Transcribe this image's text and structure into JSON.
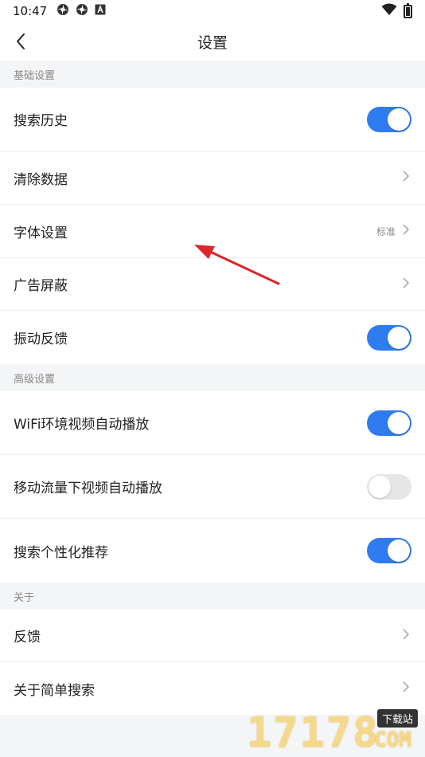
{
  "status_bar": {
    "time": "10:47"
  },
  "header": {
    "title": "设置"
  },
  "sections": {
    "basic": {
      "title": "基础设置"
    },
    "advanced": {
      "title": "高级设置"
    },
    "about": {
      "title": "关于"
    }
  },
  "rows": {
    "search_history": {
      "label": "搜索历史",
      "enabled": true
    },
    "clear_data": {
      "label": "清除数据"
    },
    "font_settings": {
      "label": "字体设置",
      "value": "标准"
    },
    "ad_block": {
      "label": "广告屏蔽"
    },
    "vibration": {
      "label": "振动反馈",
      "enabled": true
    },
    "wifi_autoplay": {
      "label": "WiFi环境视频自动播放",
      "enabled": true
    },
    "mobile_autoplay": {
      "label": "移动流量下视频自动播放",
      "enabled": false
    },
    "personalized": {
      "label": "搜索个性化推荐",
      "enabled": true
    },
    "feedback": {
      "label": "反馈"
    },
    "about_app": {
      "label": "关于简单搜索"
    }
  },
  "watermark": {
    "digits": "17178",
    "tag": "下载站",
    "domain": "COM"
  },
  "colors": {
    "accent": "#2f7cf0",
    "toggle_off": "#e6e6e6",
    "background": "#f4f5f7",
    "arrow": "#d8262a"
  },
  "icons": [
    "pinwheel-icon",
    "pinwheel-icon",
    "a-icon",
    "wifi-icon",
    "battery-icon",
    "back-arrow-icon",
    "chevron-right-icon"
  ]
}
